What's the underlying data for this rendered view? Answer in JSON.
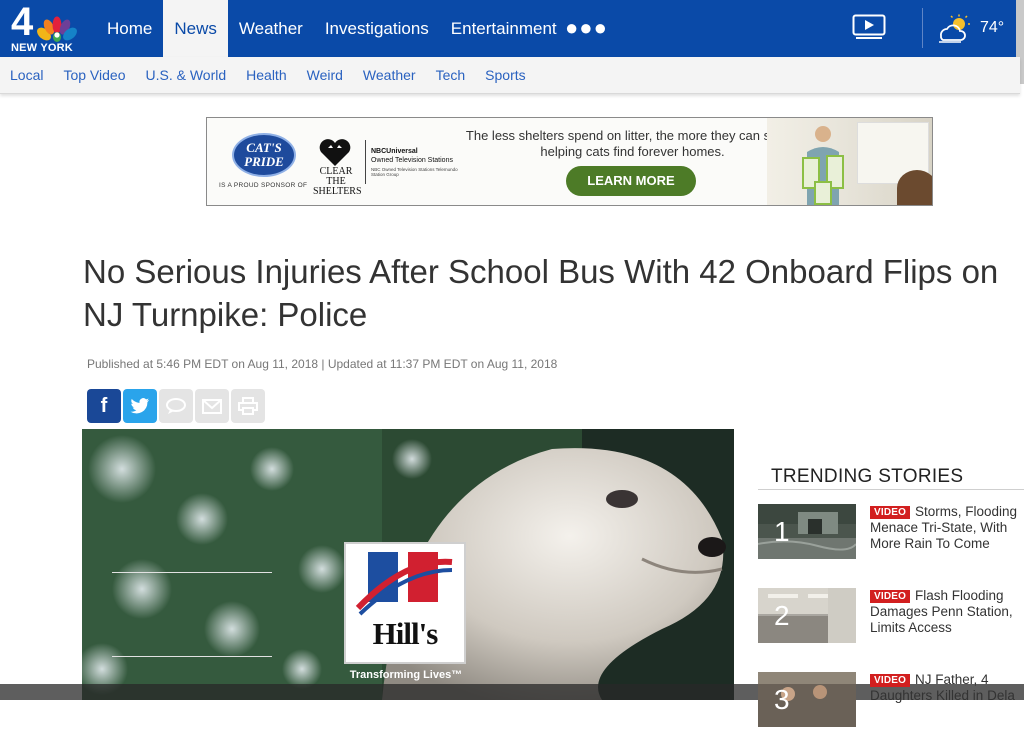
{
  "colors": {
    "brand_blue": "#0a4aa8",
    "subnav_link": "#2a62c0",
    "video_badge": "#d21f1f",
    "facebook": "#1a4897",
    "twitter": "#2aa4eb",
    "ad_button": "#4d7b27"
  },
  "header": {
    "logo": {
      "number": "4",
      "city": "NEW YORK",
      "icon": "nbc-peacock-icon"
    },
    "nav": [
      {
        "label": "Home",
        "active": false
      },
      {
        "label": "News",
        "active": true
      },
      {
        "label": "Weather",
        "active": false
      },
      {
        "label": "Investigations",
        "active": false
      },
      {
        "label": "Entertainment",
        "active": false
      }
    ],
    "more_icon": "ellipsis-icon",
    "video_icon": "video-play-icon",
    "weather": {
      "icon": "partly-cloudy-icon",
      "temperature": "74°"
    }
  },
  "subnav": [
    "Local",
    "Top Video",
    "U.S. & World",
    "Health",
    "Weird",
    "Weather",
    "Tech",
    "Sports"
  ],
  "ad": {
    "brand": "CAT'S PRIDE",
    "sponsor_line": "IS A PROUD SPONSOR OF",
    "partner": "CLEAR THE SHELTERS",
    "nbc_title": "NBCUniversal",
    "nbc_subtitle": "Owned Television Stations",
    "nbc_small": "NBC Owned Television Stations Telemundo Station Group",
    "message": "The less shelters spend on litter, the more they can spend helping cats find forever homes.",
    "cta": "LEARN MORE"
  },
  "article": {
    "headline": "No Serious Injuries After School Bus With 42 Onboard Flips on\nNJ Turnpike: Police",
    "published": "Published at 5:46 PM EDT on Aug 11, 2018 | Updated at 11:37 PM EDT on Aug 11, 2018",
    "share": [
      {
        "name": "facebook-icon",
        "label": "f"
      },
      {
        "name": "twitter-icon"
      },
      {
        "name": "comment-icon"
      },
      {
        "name": "email-icon"
      },
      {
        "name": "print-icon"
      }
    ]
  },
  "video": {
    "brand": "Hill's",
    "tagline": "Transforming Lives™"
  },
  "trending": {
    "title": "TRENDING STORIES",
    "badge": "VIDEO",
    "stories": [
      {
        "rank": "1",
        "title": "Storms, Flooding Menace Tri-State, With More Rain To Come"
      },
      {
        "rank": "2",
        "title": "Flash Flooding Damages Penn Station, Limits Access"
      },
      {
        "rank": "3",
        "title": "NJ Father, 4 Daughters Killed in Dela"
      }
    ]
  }
}
